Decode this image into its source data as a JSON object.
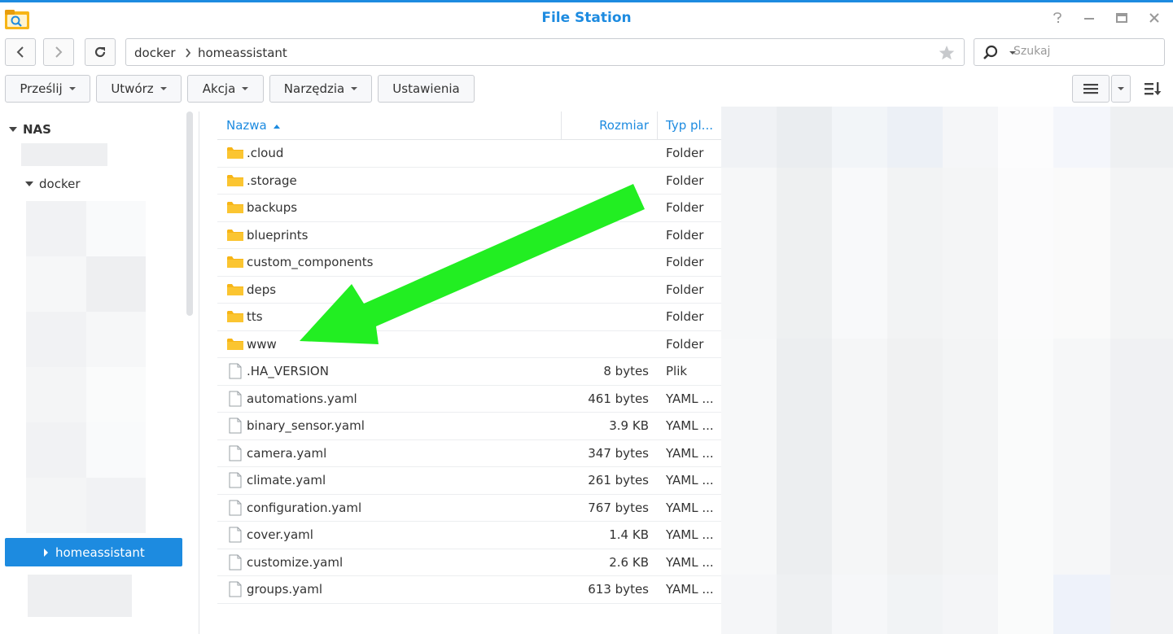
{
  "window": {
    "title": "File Station"
  },
  "nav": {
    "path": [
      "docker",
      "homeassistant"
    ]
  },
  "search": {
    "placeholder": "Szukaj"
  },
  "toolbar": {
    "upload": "Prześlij",
    "create": "Utwórz",
    "action": "Akcja",
    "tools": "Narzędzia",
    "settings": "Ustawienia"
  },
  "sidebar": {
    "root": "NAS",
    "docker": "docker",
    "selected": "homeassistant"
  },
  "list": {
    "columns": {
      "name": "Nazwa",
      "size": "Rozmiar",
      "type": "Typ pl..."
    },
    "rows": [
      {
        "name": ".cloud",
        "size": "",
        "type": "Folder",
        "kind": "folder"
      },
      {
        "name": ".storage",
        "size": "",
        "type": "Folder",
        "kind": "folder"
      },
      {
        "name": "backups",
        "size": "",
        "type": "Folder",
        "kind": "folder"
      },
      {
        "name": "blueprints",
        "size": "",
        "type": "Folder",
        "kind": "folder"
      },
      {
        "name": "custom_components",
        "size": "",
        "type": "Folder",
        "kind": "folder"
      },
      {
        "name": "deps",
        "size": "",
        "type": "Folder",
        "kind": "folder"
      },
      {
        "name": "tts",
        "size": "",
        "type": "Folder",
        "kind": "folder"
      },
      {
        "name": "www",
        "size": "",
        "type": "Folder",
        "kind": "folder"
      },
      {
        "name": ".HA_VERSION",
        "size": "8 bytes",
        "type": "Plik",
        "kind": "file"
      },
      {
        "name": "automations.yaml",
        "size": "461 bytes",
        "type": "YAML ...",
        "kind": "file"
      },
      {
        "name": "binary_sensor.yaml",
        "size": "3.9 KB",
        "type": "YAML ...",
        "kind": "file"
      },
      {
        "name": "camera.yaml",
        "size": "347 bytes",
        "type": "YAML ...",
        "kind": "file"
      },
      {
        "name": "climate.yaml",
        "size": "261 bytes",
        "type": "YAML ...",
        "kind": "file"
      },
      {
        "name": "configuration.yaml",
        "size": "767 bytes",
        "type": "YAML ...",
        "kind": "file"
      },
      {
        "name": "cover.yaml",
        "size": "1.4 KB",
        "type": "YAML ...",
        "kind": "file"
      },
      {
        "name": "customize.yaml",
        "size": "2.6 KB",
        "type": "YAML ...",
        "kind": "file"
      },
      {
        "name": "groups.yaml",
        "size": "613 bytes",
        "type": "YAML ...",
        "kind": "file"
      }
    ]
  },
  "colors": {
    "accent": "#1d8be0",
    "folder": "#f7b516",
    "highlight_arrow": "#22ee22",
    "selected_bg": "#1d8be0"
  },
  "icons": {
    "app": "file-station-icon",
    "back": "chevron-left-icon",
    "forward": "chevron-right-icon",
    "refresh": "refresh-icon",
    "favorite": "star-icon",
    "search": "search-icon",
    "list_view": "list-view-icon",
    "sort": "sort-icon"
  }
}
